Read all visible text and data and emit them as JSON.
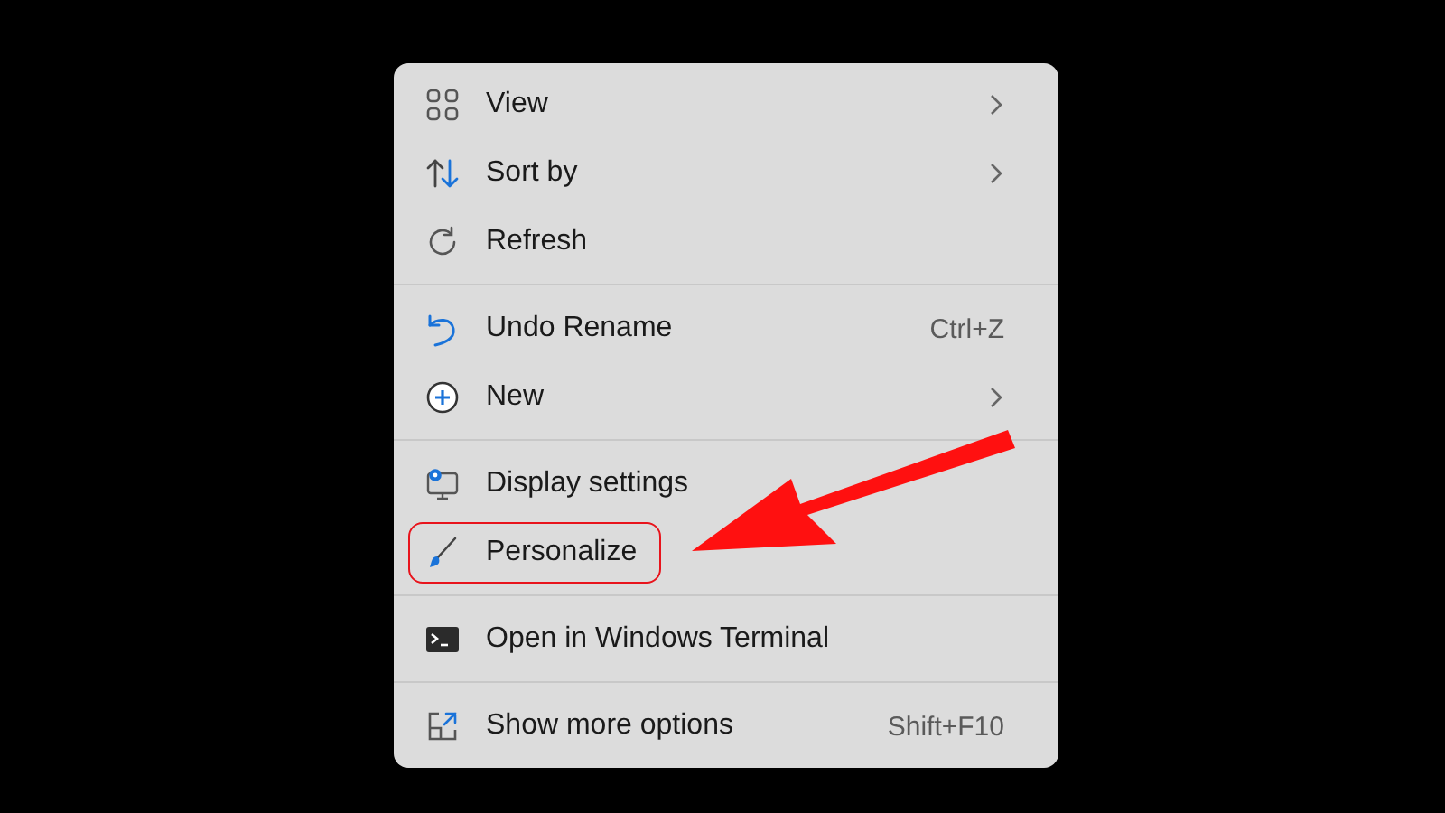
{
  "context_menu": {
    "groups": [
      {
        "items": [
          {
            "kind": "grid",
            "label": "View",
            "submenu": true,
            "highlighted": false
          },
          {
            "kind": "sort",
            "label": "Sort by",
            "submenu": true,
            "highlighted": false
          },
          {
            "kind": "refresh",
            "label": "Refresh",
            "submenu": false,
            "highlighted": false
          }
        ]
      },
      {
        "items": [
          {
            "kind": "undo",
            "label": "Undo Rename",
            "shortcut": "Ctrl+Z",
            "submenu": false,
            "highlighted": false
          },
          {
            "kind": "plus",
            "label": "New",
            "submenu": true,
            "highlighted": false
          }
        ]
      },
      {
        "items": [
          {
            "kind": "display",
            "label": "Display settings",
            "submenu": false,
            "highlighted": false
          },
          {
            "kind": "brush",
            "label": "Personalize",
            "submenu": false,
            "highlighted": true
          }
        ]
      },
      {
        "items": [
          {
            "kind": "terminal",
            "label": "Open in Windows Terminal",
            "submenu": false,
            "highlighted": false
          }
        ]
      },
      {
        "items": [
          {
            "kind": "share",
            "label": "Show more options",
            "shortcut": "Shift+F10",
            "submenu": false,
            "highlighted": false
          }
        ]
      }
    ]
  },
  "annotation": {
    "kind": "arrow"
  }
}
